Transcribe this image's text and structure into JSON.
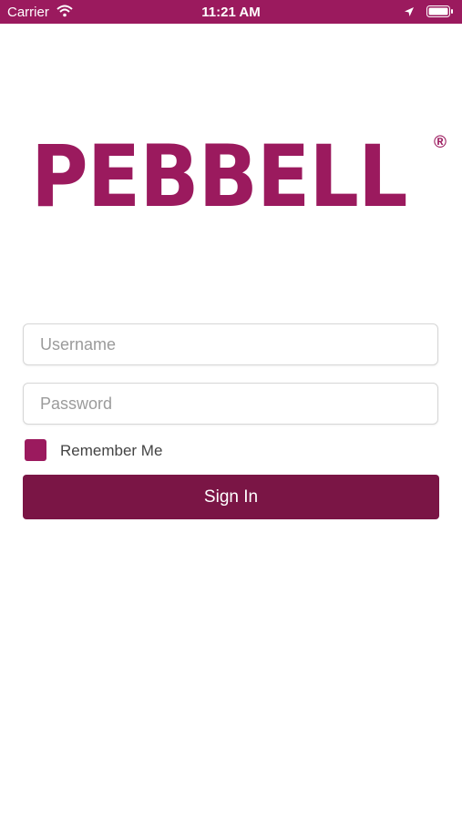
{
  "status_bar": {
    "carrier": "Carrier",
    "time": "11:21 AM",
    "icons": [
      "wifi-icon",
      "location-arrow-icon",
      "battery-icon"
    ]
  },
  "brand": {
    "name": "PEBBELL",
    "registered_mark": "®",
    "color": "#9b1a5e"
  },
  "login": {
    "username_placeholder": "Username",
    "username_value": "",
    "password_placeholder": "Password",
    "password_value": "",
    "remember_label": "Remember Me",
    "sign_in_label": "Sign In",
    "button_color": "#7a1545"
  }
}
